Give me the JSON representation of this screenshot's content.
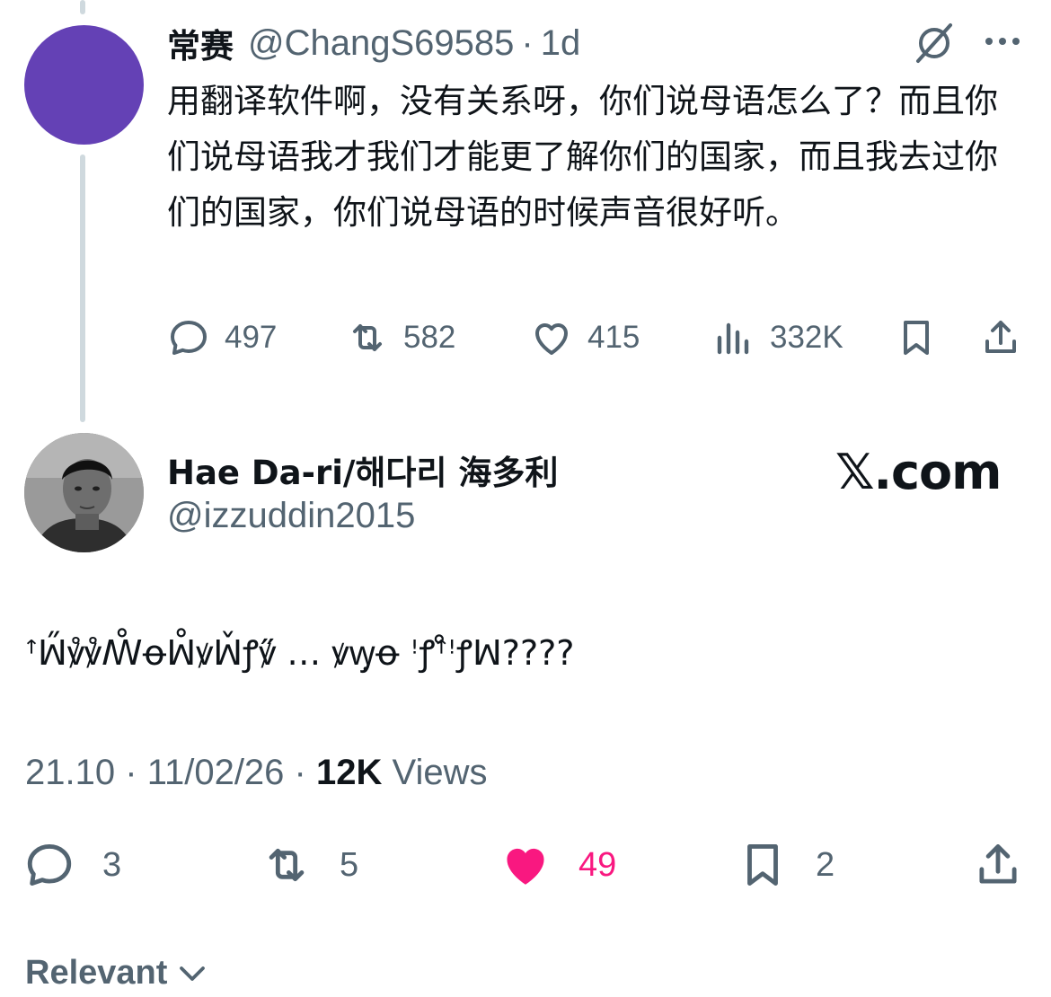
{
  "reply": {
    "display_name": "常赛",
    "handle": "@ChangS69585",
    "separator": "·",
    "time": "1d",
    "text": "用翻译软件啊，没有关系呀，你们说母语怎么了？而且你们说母语我才我们才能更了解你们的国家，而且我去过你们的国家，你们说母语的时候声音很好听。",
    "actions": {
      "replies": "497",
      "reposts": "582",
      "likes": "415",
      "views": "332K"
    },
    "icons": [
      "grok-icon",
      "more-icon",
      "reply-icon",
      "repost-icon",
      "like-icon",
      "views-icon",
      "bookmark-icon",
      "share-icon"
    ]
  },
  "main": {
    "display_name": "Hae Da-ri/해다리 海多利",
    "handle": "@izzuddin2015",
    "watermark": "𝕏.com",
    "text": "ꜛꟽ̋ꝟ̊ꝟ̊ꟿ̊ꝋꟽ̊ꝟꟽ̌ꝭꝟ̋ … ꝟꝡ̣ꝋ ꜝꝭꜛ̊ꜝꝭꟽ????",
    "meta": {
      "time": "21.10",
      "sep1": "·",
      "date": "11/02/26",
      "sep2": "·",
      "views_count": "12K",
      "views_label": "Views"
    },
    "actions": {
      "replies": "3",
      "reposts": "5",
      "likes": "49",
      "bookmarks": "2"
    },
    "colors": {
      "liked": "#f91880",
      "secondary_text": "#536471",
      "thread_line": "#cfd9de"
    }
  },
  "sort": {
    "label": "Relevant"
  }
}
